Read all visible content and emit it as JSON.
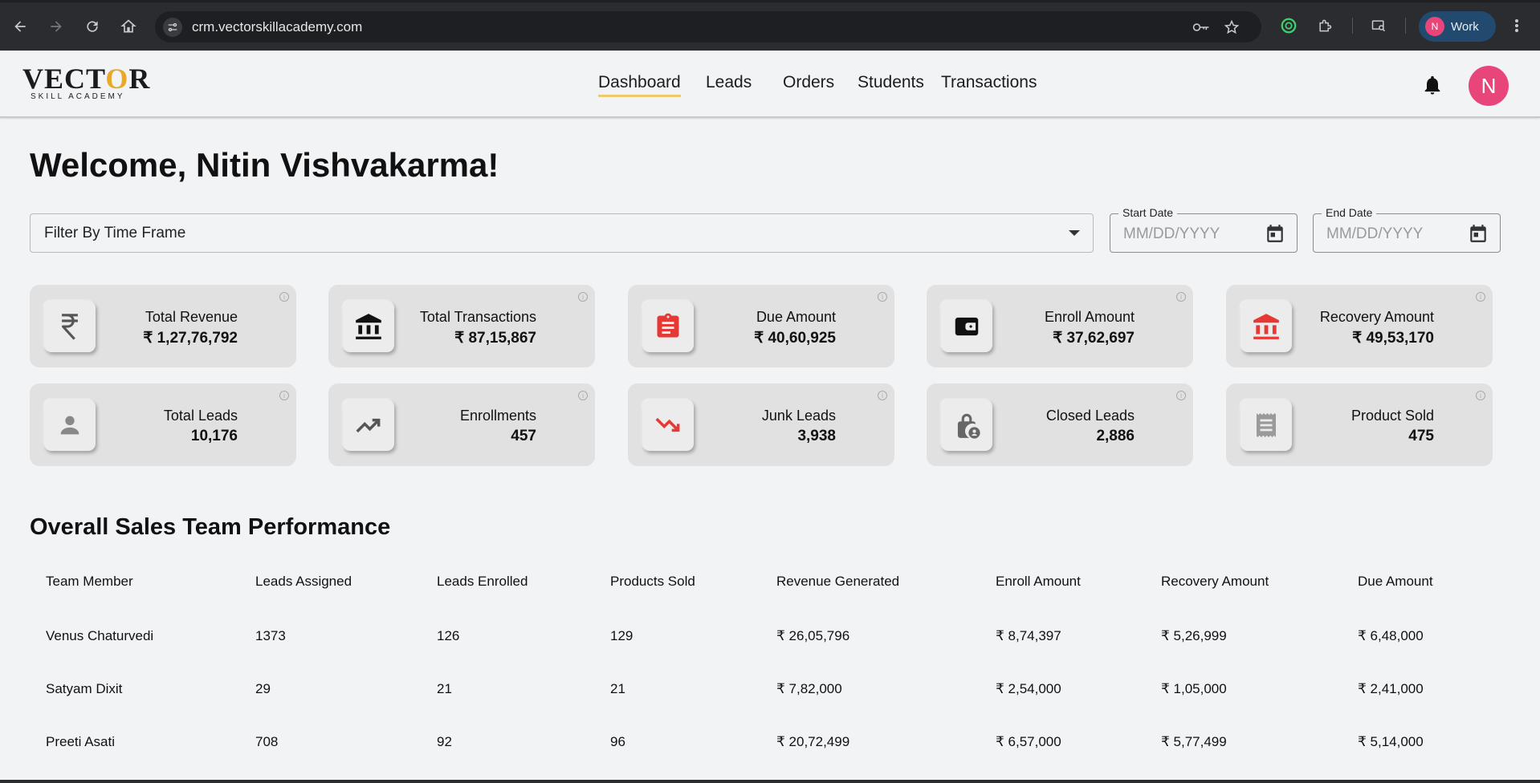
{
  "browser": {
    "url": "crm.vectorskillacademy.com",
    "profile_initial": "N",
    "profile_label": "Work"
  },
  "app": {
    "logo_word_a": "VECT",
    "logo_word_o": "O",
    "logo_word_b": "R",
    "logo_sub": "SKILL ACADEMY",
    "nav": [
      "Dashboard",
      "Leads",
      "Orders",
      "Students",
      "Transactions"
    ],
    "active_nav": "Dashboard",
    "avatar_initial": "N"
  },
  "welcome": "Welcome, Nitin Vishvakarma!",
  "filter": {
    "label": "Filter By Time Frame",
    "start_label": "Start Date",
    "start_placeholder": "MM/DD/YYYY",
    "end_label": "End Date",
    "end_placeholder": "MM/DD/YYYY"
  },
  "stats": [
    {
      "title": "Total Revenue",
      "value": "₹ 1,27,76,792",
      "icon": "rupee-icon",
      "icon_color": "#555555"
    },
    {
      "title": "Total Transactions",
      "value": "₹ 87,15,867",
      "icon": "bank-icon",
      "icon_color": "#111111"
    },
    {
      "title": "Due Amount",
      "value": "₹ 40,60,925",
      "icon": "clipboard-icon",
      "icon_color": "#e53935"
    },
    {
      "title": "Enroll Amount",
      "value": "₹ 37,62,697",
      "icon": "wallet-icon",
      "icon_color": "#111111"
    },
    {
      "title": "Recovery Amount",
      "value": "₹ 49,53,170",
      "icon": "bank-icon",
      "icon_color": "#e53935"
    },
    {
      "title": "Total Leads",
      "value": "10,176",
      "icon": "person-icon",
      "icon_color": "#888888"
    },
    {
      "title": "Enrollments",
      "value": "457",
      "icon": "trending-up-icon",
      "icon_color": "#555555"
    },
    {
      "title": "Junk Leads",
      "value": "3,938",
      "icon": "trending-down-icon",
      "icon_color": "#e53935"
    },
    {
      "title": "Closed Leads",
      "value": "2,886",
      "icon": "lock-person-icon",
      "icon_color": "#666666"
    },
    {
      "title": "Product Sold",
      "value": "475",
      "icon": "receipt-icon",
      "icon_color": "#999999"
    }
  ],
  "performance": {
    "title": "Overall Sales Team Performance",
    "columns": [
      "Team Member",
      "Leads Assigned",
      "Leads Enrolled",
      "Products Sold",
      "Revenue Generated",
      "Enroll Amount",
      "Recovery Amount",
      "Due Amount"
    ],
    "rows": [
      [
        "Venus Chaturvedi",
        "1373",
        "126",
        "129",
        "₹ 26,05,796",
        "₹ 8,74,397",
        "₹ 5,26,999",
        "₹ 6,48,000"
      ],
      [
        "Satyam Dixit",
        "29",
        "21",
        "21",
        "₹ 7,82,000",
        "₹ 2,54,000",
        "₹ 1,05,000",
        "₹ 2,41,000"
      ],
      [
        "Preeti Asati",
        "708",
        "92",
        "96",
        "₹ 20,72,499",
        "₹ 6,57,000",
        "₹ 5,77,499",
        "₹ 5,14,000"
      ]
    ]
  }
}
